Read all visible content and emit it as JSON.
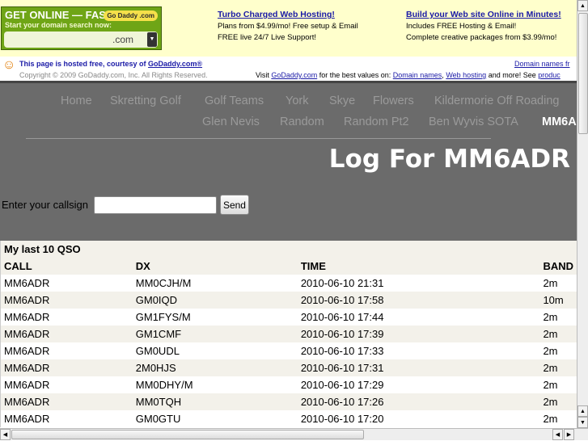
{
  "ad": {
    "godaddy_box": {
      "title": "GET ONLINE — FAST!",
      "subtitle": "Start your domain search now:",
      "logo": "Go Daddy .com",
      "tld": ".com"
    },
    "col1": {
      "link": "Turbo Charged Web Hosting!",
      "line1": "Plans from $4.99/mo! Free setup & Email",
      "line2": "FREE live 24/7 Live Support!"
    },
    "col2": {
      "link": "Build your Web site Online in Minutes!",
      "line1": "Includes FREE Hosting & Email!",
      "line2": "Complete creative packages from $3.99/mo!"
    }
  },
  "hosted": {
    "line1": "This page is hosted free, courtesy of ",
    "line1_link": "GoDaddy.com®",
    "copyright": "Copyright © 2009 GoDaddy.com, Inc. All Rights Reserved.",
    "right1": "Domain names fr",
    "visit": "Visit ",
    "visit_link": "GoDaddy.com",
    "visit_mid": " for the best values on: ",
    "link_domains": "Domain names",
    "comma": ", ",
    "link_hosting": "Web hosting",
    "visit_end": " and more! See ",
    "link_products": "produc"
  },
  "nav": [
    "Home",
    "Skretting Golf",
    "Golf Teams",
    "York",
    "Skye",
    "Flowers",
    "Kildermorie Off Roading",
    "Glen Nevis",
    "Random",
    "Random Pt2",
    "Ben Wyvis SOTA",
    "MM6A"
  ],
  "page_title": "Log For MM6ADR",
  "form": {
    "label": "Enter your callsign",
    "value": "",
    "send": "Send"
  },
  "table": {
    "caption": "My last 10 QSO",
    "headers": [
      "CALL",
      "DX",
      "TIME",
      "BAND"
    ],
    "rows": [
      [
        "MM6ADR",
        "MM0CJH/M",
        "2010-06-10 21:31",
        "2m"
      ],
      [
        "MM6ADR",
        "GM0IQD",
        "2010-06-10 17:58",
        "10m"
      ],
      [
        "MM6ADR",
        "GM1FYS/M",
        "2010-06-10 17:44",
        "2m"
      ],
      [
        "MM6ADR",
        "GM1CMF",
        "2010-06-10 17:39",
        "2m"
      ],
      [
        "MM6ADR",
        "GM0UDL",
        "2010-06-10 17:33",
        "2m"
      ],
      [
        "MM6ADR",
        "2M0HJS",
        "2010-06-10 17:31",
        "2m"
      ],
      [
        "MM6ADR",
        "MM0DHY/M",
        "2010-06-10 17:29",
        "2m"
      ],
      [
        "MM6ADR",
        "MM0TQH",
        "2010-06-10 17:26",
        "2m"
      ],
      [
        "MM6ADR",
        "GM0GTU",
        "2010-06-10 17:20",
        "2m"
      ]
    ]
  }
}
